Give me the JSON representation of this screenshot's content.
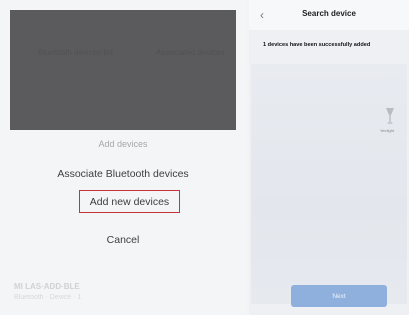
{
  "left": {
    "header_text_1": "Bluetooth devices list",
    "header_text_2": "Associated devices",
    "sheet": {
      "title": "Add devices",
      "associate_label": "Associate Bluetooth devices",
      "add_new_label": "Add new devices",
      "cancel_label": "Cancel"
    },
    "ghost_text_1": "MI LAS·ADD·BLE",
    "ghost_text_2": "Bluetooth · Device · 1"
  },
  "right": {
    "nav": {
      "back_icon": "chevron-left-icon",
      "title": "Search device"
    },
    "status_message": "1 devices have been successfully added",
    "device": {
      "icon": "device-icon",
      "label": "Yeelight"
    },
    "next_label": "Next"
  },
  "colors": {
    "highlight_border": "#c8323a",
    "next_button": "#8fb0dc",
    "header_dim": "#5b5b5d"
  }
}
